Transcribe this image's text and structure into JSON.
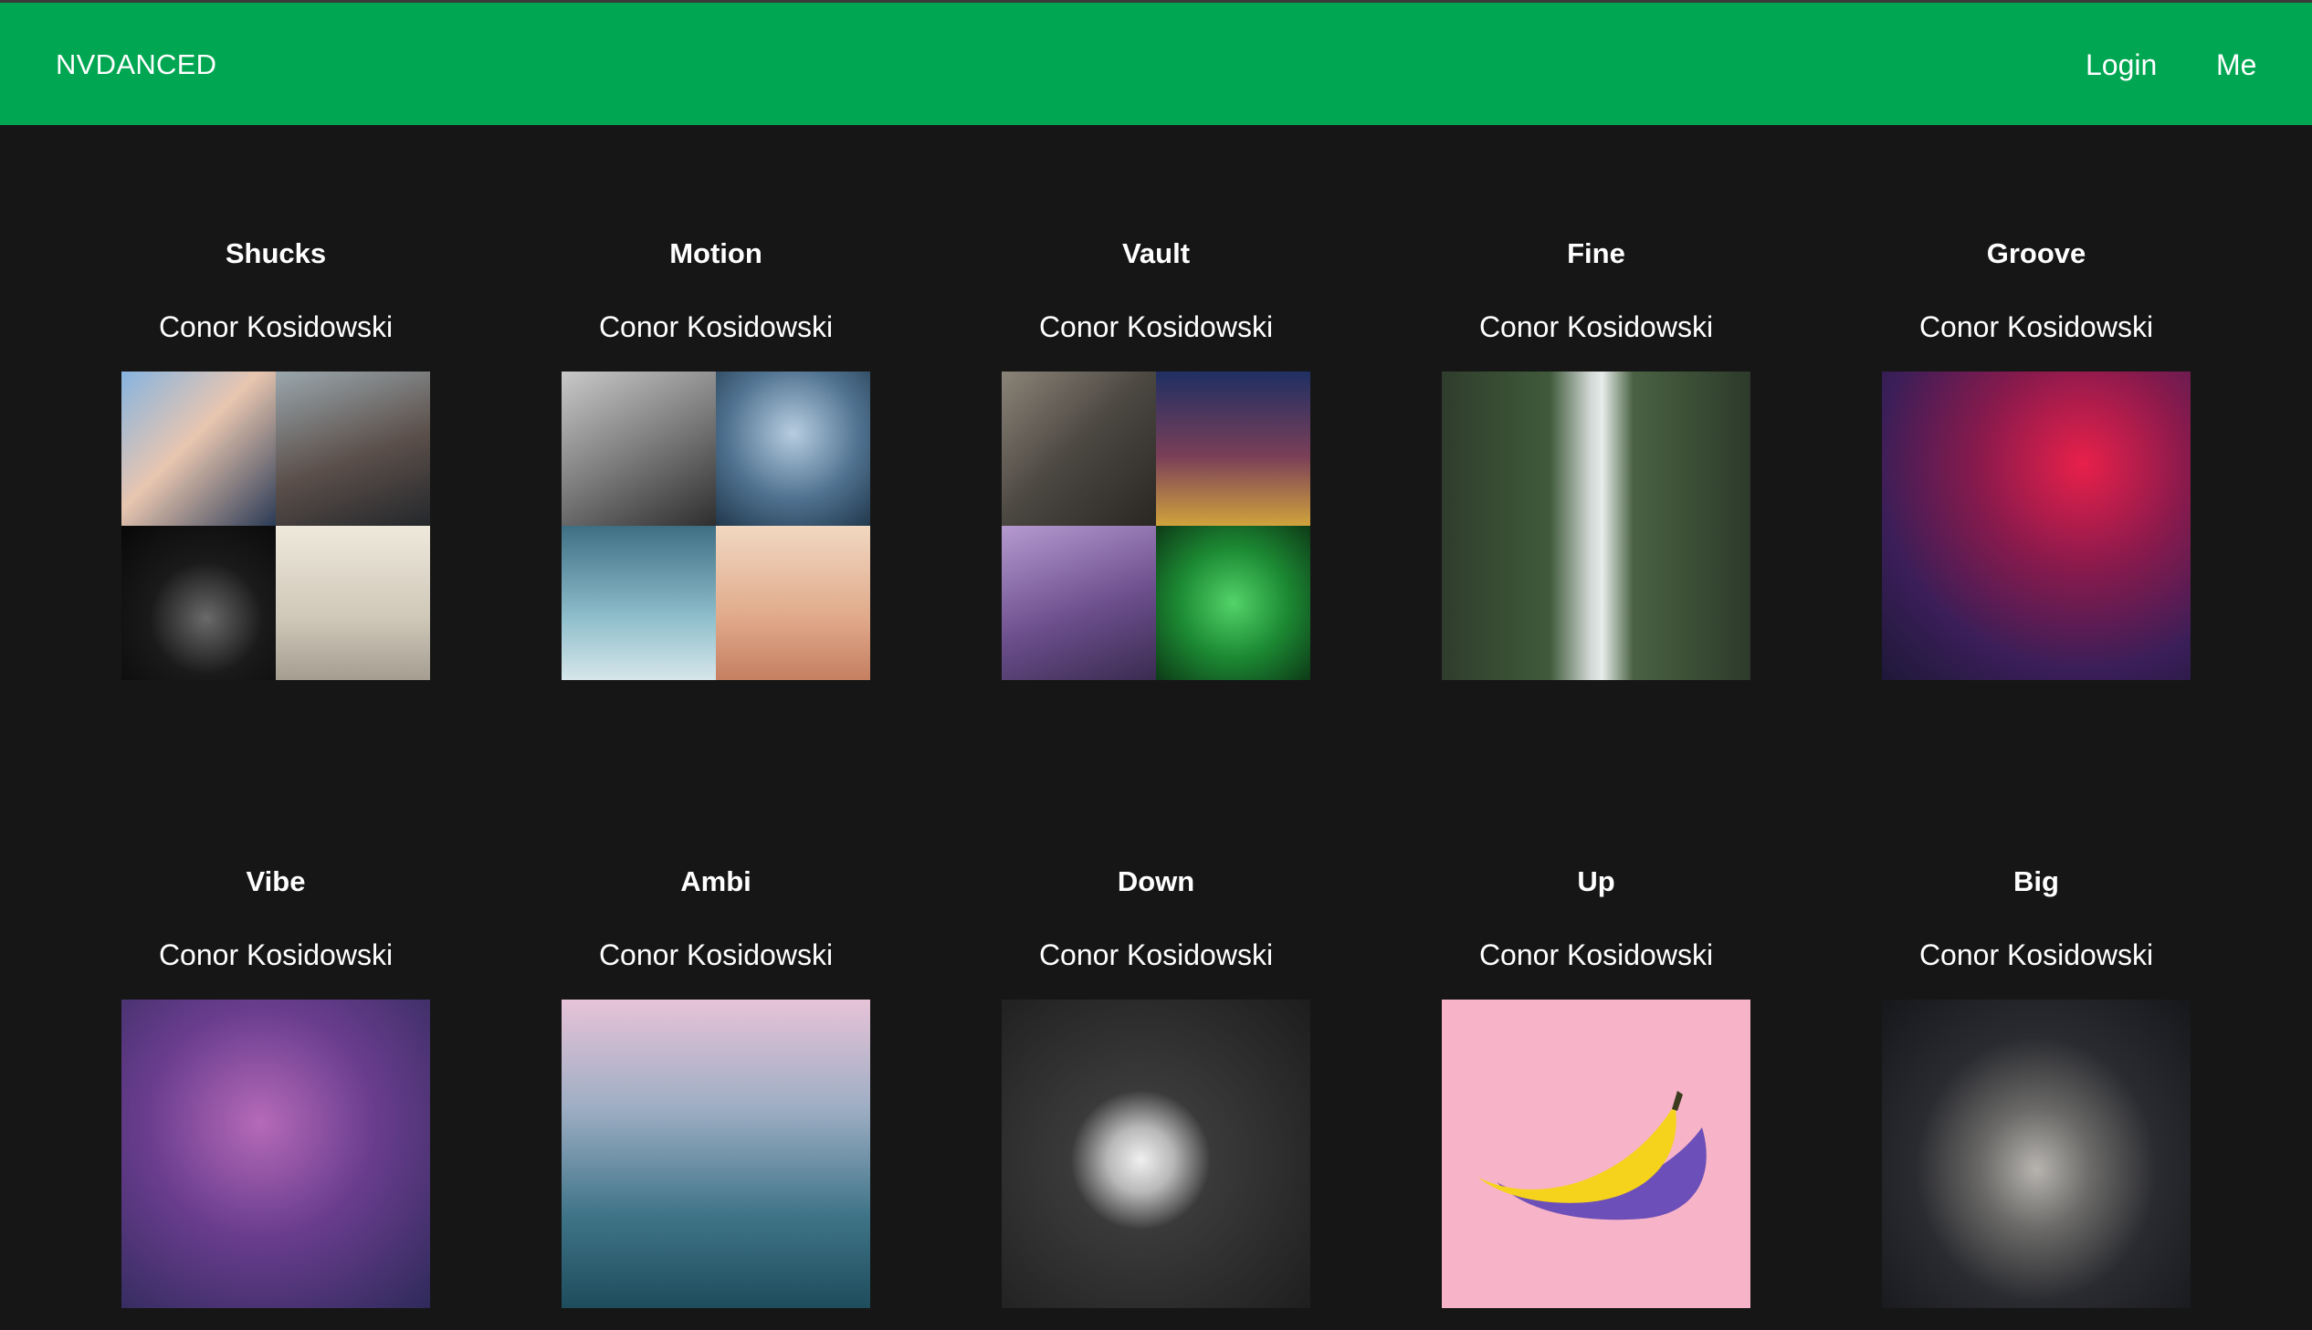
{
  "header": {
    "brand": "NVDANCED",
    "links": [
      {
        "label": "Login"
      },
      {
        "label": "Me"
      }
    ]
  },
  "playlists": [
    {
      "title": "Shucks",
      "artist": "Conor Kosidowski",
      "cover_type": "mosaic",
      "colors": [
        "#5a7fa8",
        "#6d7780",
        "#1b1b1b",
        "#d8d2c6"
      ]
    },
    {
      "title": "Motion",
      "artist": "Conor Kosidowski",
      "cover_type": "mosaic",
      "colors": [
        "#8c8c8c",
        "#4a6a86",
        "#6f9cad",
        "#d9a689"
      ]
    },
    {
      "title": "Vault",
      "artist": "Conor Kosidowski",
      "cover_type": "mosaic",
      "colors": [
        "#5f5a52",
        "#2b3458",
        "#6b4f86",
        "#1c7a2e"
      ]
    },
    {
      "title": "Fine",
      "artist": "Conor Kosidowski",
      "cover_type": "single",
      "colors": [
        "#3d4a38"
      ]
    },
    {
      "title": "Groove",
      "artist": "Conor Kosidowski",
      "cover_type": "single",
      "colors": [
        "#5c1a3e"
      ]
    },
    {
      "title": "Vibe",
      "artist": "Conor Kosidowski",
      "cover_type": "single",
      "colors": [
        "#5a3a86"
      ]
    },
    {
      "title": "Ambi",
      "artist": "Conor Kosidowski",
      "cover_type": "single",
      "colors": [
        "#3f6f86"
      ]
    },
    {
      "title": "Down",
      "artist": "Conor Kosidowski",
      "cover_type": "single",
      "colors": [
        "#2b2b2b"
      ]
    },
    {
      "title": "Up",
      "artist": "Conor Kosidowski",
      "cover_type": "single",
      "colors": [
        "#f7b3c8"
      ]
    },
    {
      "title": "Big",
      "artist": "Conor Kosidowski",
      "cover_type": "single",
      "colors": [
        "#24262c"
      ]
    }
  ]
}
